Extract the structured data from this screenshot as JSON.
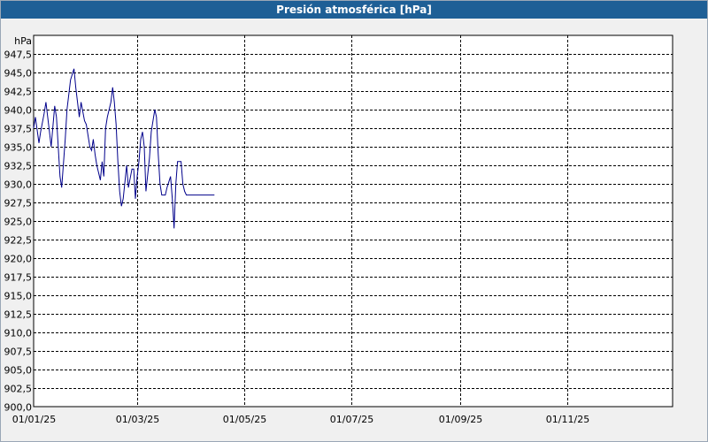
{
  "window": {
    "title": "Presión atmosférica [hPa]"
  },
  "chart_data": {
    "type": "line",
    "title": "Presión atmosférica [hPa]",
    "ylabel": "hPa",
    "xlabel": "",
    "ylim": [
      900.0,
      950.0
    ],
    "xlim": [
      "2025-01-01",
      "2025-12-31"
    ],
    "grid": true,
    "y_ticks": [
      "900,0",
      "902,5",
      "905,0",
      "907,5",
      "910,0",
      "912,5",
      "915,0",
      "917,5",
      "920,0",
      "922,5",
      "925,0",
      "927,5",
      "930,0",
      "932,5",
      "935,0",
      "937,5",
      "940,0",
      "942,5",
      "945,0",
      "947,5"
    ],
    "x_ticks": [
      {
        "date": "2025-01-01",
        "label": "01/01/25"
      },
      {
        "date": "2025-03-01",
        "label": "01/03/25"
      },
      {
        "date": "2025-05-01",
        "label": "01/05/25"
      },
      {
        "date": "2025-07-01",
        "label": "01/07/25"
      },
      {
        "date": "2025-09-01",
        "label": "01/09/25"
      },
      {
        "date": "2025-11-01",
        "label": "01/11/25"
      }
    ],
    "series": [
      {
        "color": "#00008b",
        "x": [
          "2025-01-01",
          "2025-01-02",
          "2025-01-04",
          "2025-01-05",
          "2025-01-07",
          "2025-01-08",
          "2025-01-10",
          "2025-01-11",
          "2025-01-13",
          "2025-01-14",
          "2025-01-16",
          "2025-01-17",
          "2025-01-19",
          "2025-01-20",
          "2025-01-21",
          "2025-01-22",
          "2025-01-24",
          "2025-01-25",
          "2025-01-27",
          "2025-01-28",
          "2025-01-30",
          "2025-01-31",
          "2025-02-02",
          "2025-02-03",
          "2025-02-04",
          "2025-02-05",
          "2025-02-06",
          "2025-02-08",
          "2025-02-09",
          "2025-02-10",
          "2025-02-11",
          "2025-02-12",
          "2025-02-14",
          "2025-02-15",
          "2025-02-16",
          "2025-02-17",
          "2025-02-18",
          "2025-02-19",
          "2025-02-20",
          "2025-02-21",
          "2025-02-23",
          "2025-02-24",
          "2025-02-26",
          "2025-02-27",
          "2025-02-28",
          "2025-03-01",
          "2025-03-02",
          "2025-03-03",
          "2025-03-04",
          "2025-03-05",
          "2025-03-06",
          "2025-03-08",
          "2025-03-09",
          "2025-03-10",
          "2025-03-11",
          "2025-03-12",
          "2025-03-13",
          "2025-03-14",
          "2025-03-15",
          "2025-03-17",
          "2025-03-18",
          "2025-03-20",
          "2025-03-21",
          "2025-03-22",
          "2025-03-23",
          "2025-03-24",
          "2025-03-26",
          "2025-03-27",
          "2025-03-28",
          "2025-03-29",
          "2025-03-30",
          "2025-04-01",
          "2025-04-02",
          "2025-04-03",
          "2025-04-04",
          "2025-04-05",
          "2025-04-06",
          "2025-04-07",
          "2025-04-08",
          "2025-04-09",
          "2025-04-11",
          "2025-04-12",
          "2025-04-14"
        ],
        "y": [
          937.5,
          939.0,
          935.5,
          937.0,
          939.5,
          941.0,
          937.0,
          935.0,
          940.5,
          939.0,
          931.0,
          929.5,
          936.0,
          940.0,
          942.0,
          944.0,
          945.5,
          943.0,
          939.0,
          941.0,
          938.5,
          938.0,
          935.0,
          934.5,
          936.0,
          934.0,
          932.5,
          930.5,
          933.0,
          931.0,
          937.5,
          939.0,
          941.0,
          943.0,
          941.0,
          938.0,
          933.0,
          929.0,
          927.0,
          928.0,
          932.5,
          929.5,
          932.0,
          932.0,
          928.0,
          931.0,
          933.0,
          936.0,
          937.0,
          935.0,
          929.0,
          933.5,
          937.0,
          938.5,
          940.0,
          939.0,
          934.0,
          930.0,
          928.5,
          928.5,
          929.5,
          931.0,
          928.0,
          924.0,
          930.0,
          933.0,
          933.0,
          930.0,
          929.0,
          928.5,
          928.5,
          928.5,
          928.5,
          928.5,
          928.5,
          928.5,
          928.5,
          928.5,
          928.5,
          928.5,
          928.5,
          928.5,
          928.5
        ]
      }
    ]
  }
}
